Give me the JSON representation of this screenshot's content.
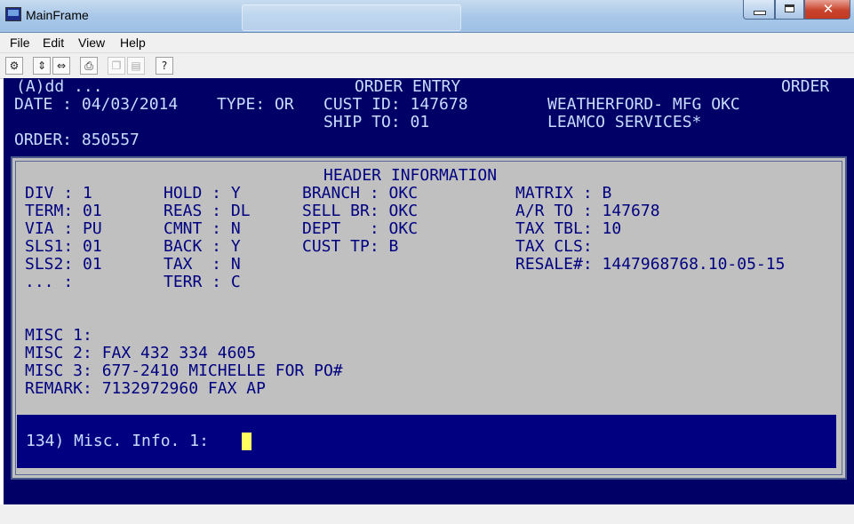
{
  "window": {
    "title": "MainFrame"
  },
  "menu": [
    "File",
    "Edit",
    "View",
    "Help"
  ],
  "toolbar": {
    "buttons": [
      "properties-icon",
      "connect-icon",
      "disconnect-icon",
      "print-icon",
      "copy-icon",
      "paste-icon",
      "help-icon"
    ],
    "help_glyph": "?"
  },
  "screen": {
    "row0_left": "(A)dd ...",
    "row0_center": "ORDER ENTRY",
    "row0_right": "ORDER",
    "date": "DATE : 04/03/2014",
    "type": "TYPE: OR",
    "cust_id": "CUST ID: 147678",
    "customer_name": "WEATHERFORD- MFG OKC",
    "ship_to": "SHIP TO: 01",
    "ship_name": "LEAMCO SERVICES*",
    "order": "ORDER: 850557",
    "header_title": "HEADER INFORMATION",
    "col1": [
      "DIV : 1",
      "TERM: 01",
      "VIA : PU",
      "SLS1: 01",
      "SLS2: 01",
      "... :"
    ],
    "col2": [
      "HOLD : Y",
      "REAS : DL",
      "CMNT : N",
      "BACK : Y",
      "TAX  : N",
      "TERR : C"
    ],
    "col3": [
      "BRANCH : OKC",
      "SELL BR: OKC",
      "DEPT   : OKC",
      "CUST TP: B"
    ],
    "col4": [
      "MATRIX : B",
      "A/R TO : 147678",
      "TAX TBL: 10",
      "TAX CLS:",
      "RESALE#: 1447968768.10-05-15"
    ],
    "misc": [
      "MISC 1:",
      "MISC 2: FAX 432 334 4605",
      "MISC 3: 677-2410 MICHELLE FOR PO#",
      "REMARK: 7132972960 FAX AP"
    ],
    "prompt": "134) Misc. Info. 1:"
  },
  "colors": {
    "screen_bg": "#000066",
    "panel_bg": "#c0c0c0",
    "panel_text": "#000080",
    "cursor": "#ffff60"
  }
}
